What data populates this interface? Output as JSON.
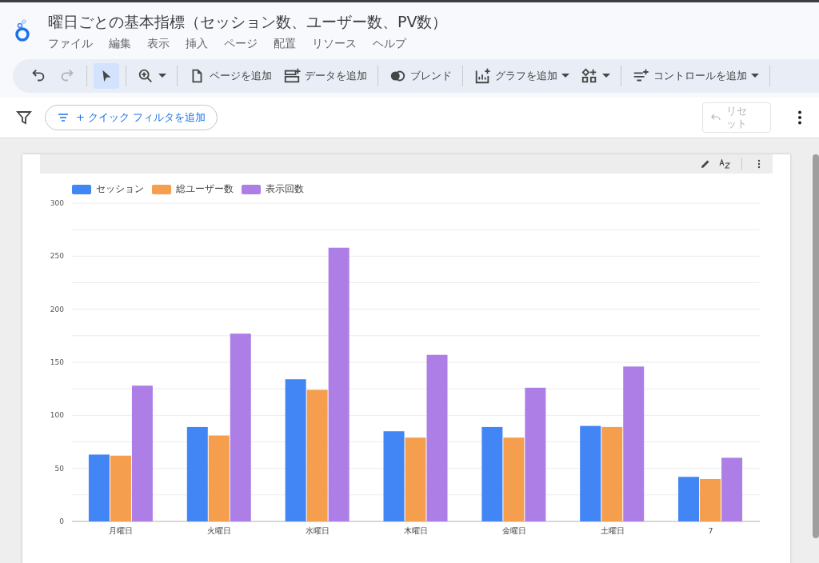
{
  "report": {
    "title": "曜日ごとの基本指標（セッション数、ユーザー数、PV数）"
  },
  "menu": [
    "ファイル",
    "編集",
    "表示",
    "挿入",
    "ページ",
    "配置",
    "リソース",
    "ヘルプ"
  ],
  "toolbar": [
    {
      "kind": "undo",
      "disabled": false,
      "selected": false
    },
    {
      "kind": "redo",
      "disabled": true,
      "selected": false
    },
    {
      "kind": "select",
      "disabled": false,
      "selected": true
    },
    {
      "kind": "zoom",
      "disabled": false,
      "selected": false
    },
    {
      "kind": "page",
      "label": "ページを追加",
      "disabled": false,
      "selected": false
    },
    {
      "kind": "data",
      "label": "データを追加",
      "disabled": false,
      "selected": false
    },
    {
      "kind": "blend",
      "label": "ブレンド",
      "disabled": false,
      "selected": false
    },
    {
      "kind": "chart",
      "label": "グラフを追加",
      "disabled": false,
      "selected": false
    },
    {
      "kind": "components",
      "disabled": false,
      "selected": false
    },
    {
      "kind": "control",
      "label": "コントロールを追加",
      "disabled": false,
      "selected": false
    }
  ],
  "filter_bar": {
    "quick_filter": "+ クイック フィルタを追加",
    "reset": "リセット",
    "reset_disabled": true
  },
  "chart": {
    "chart_data": {
      "type": "bar",
      "categories": [
        "月曜日",
        "火曜日",
        "水曜日",
        "木曜日",
        "金曜日",
        "土曜日",
        "7"
      ],
      "series": [
        {
          "name": "セッション",
          "color": "#4285f4",
          "values": [
            63,
            89,
            134,
            85,
            89,
            90,
            42
          ]
        },
        {
          "name": "総ユーザー数",
          "color": "#f59e4e",
          "values": [
            62,
            81,
            124,
            79,
            79,
            89,
            40
          ]
        },
        {
          "name": "表示回数",
          "color": "#ad7fe6",
          "values": [
            128,
            177,
            258,
            157,
            126,
            146,
            60
          ]
        }
      ],
      "grid": true,
      "ylim": [
        0,
        300
      ],
      "yticks": [
        0,
        50,
        100,
        150,
        200,
        250,
        300
      ]
    }
  }
}
